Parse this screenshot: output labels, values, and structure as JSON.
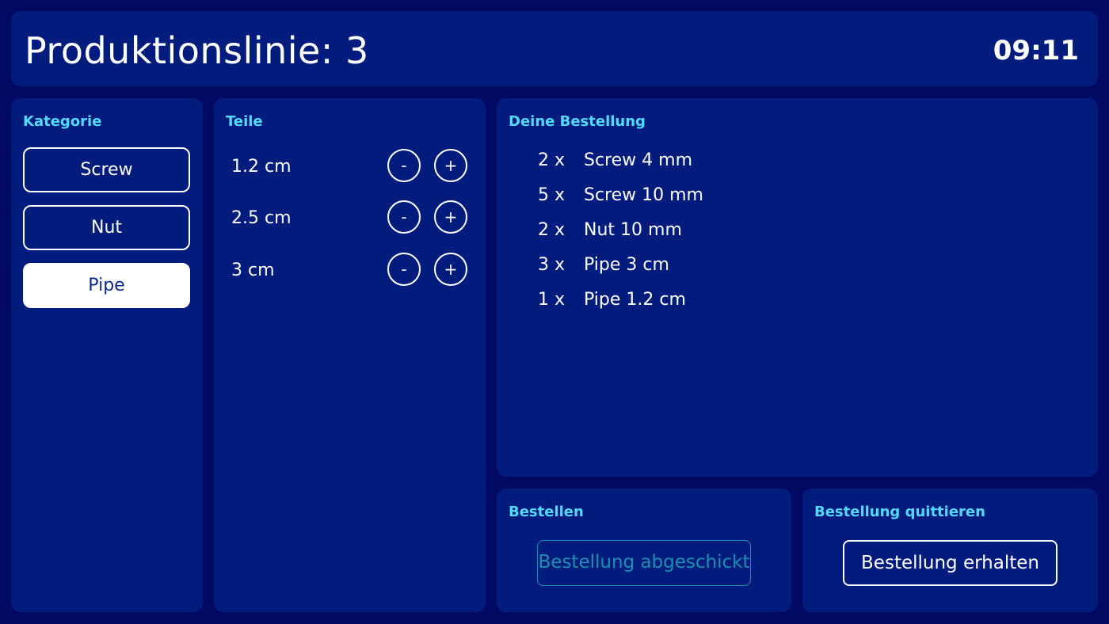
{
  "header": {
    "title": "Produktionslinie: 3",
    "time": "09:11"
  },
  "kategorie": {
    "title": "Kategorie",
    "items": [
      {
        "label": "Screw",
        "selected": false
      },
      {
        "label": "Nut",
        "selected": false
      },
      {
        "label": "Pipe",
        "selected": true
      }
    ]
  },
  "teile": {
    "title": "Teile",
    "items": [
      {
        "label": "1.2 cm",
        "minus": "-",
        "plus": "+"
      },
      {
        "label": "2.5 cm",
        "minus": "-",
        "plus": "+"
      },
      {
        "label": "3 cm",
        "minus": "-",
        "plus": "+"
      }
    ]
  },
  "bestellung": {
    "title": "Deine Bestellung",
    "items": [
      {
        "qty": "2 x",
        "name": "Screw 4 mm"
      },
      {
        "qty": "5 x",
        "name": "Screw 10 mm"
      },
      {
        "qty": "2 x",
        "name": "Nut 10 mm"
      },
      {
        "qty": "3 x",
        "name": "Pipe 3 cm"
      },
      {
        "qty": "1 x",
        "name": "Pipe 1.2 cm"
      }
    ]
  },
  "bestellen": {
    "title": "Bestellen",
    "button_label": "Bestellung abgeschickt",
    "button_disabled": true
  },
  "quittieren": {
    "title": "Bestellung quittieren",
    "button_label": "Bestellung erhalten"
  },
  "colors": {
    "background": "#010a63",
    "panel": "#021c7e",
    "accent": "#55d8ff",
    "disabled": "#1a8fb0"
  }
}
